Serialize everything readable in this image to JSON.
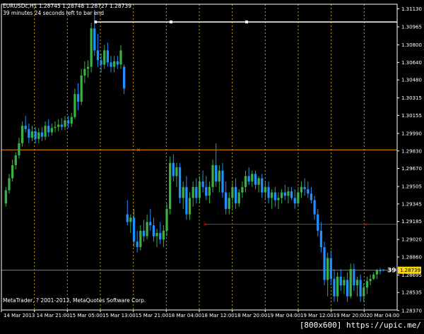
{
  "header": {
    "symbol_line": "EURUSDc,H1  1.28745 1.28748 1.28727 1.28739",
    "countdown": "39 minutes 24 seconds left to bar end"
  },
  "copyright": "MetaTrader, ? 2001-2013, MetaQuotes Software Corp.",
  "countdown_short": "39",
  "watermark": "[800x600] https://upic.me/",
  "colors": {
    "background": "#000000",
    "bull": "#3cb043",
    "bear": "#1e90ff",
    "grid": "#c8a000",
    "axis": "#ffffff",
    "orange_line": "#ff8c00",
    "red_line": "#ff0000",
    "white_line": "#ffffff",
    "price_label_bg": "#ffd700"
  },
  "chart_data": {
    "type": "candlestick",
    "ylim": [
      1.28375,
      1.31172
    ],
    "y_ticks": [
      "1.31130",
      "1.30965",
      "1.30800",
      "1.30640",
      "1.30480",
      "1.30315",
      "1.30155",
      "1.29990",
      "1.29830",
      "1.29670",
      "1.29505",
      "1.29345",
      "1.29185",
      "1.29020",
      "1.28860",
      "1.28695",
      "1.28535",
      "1.28370"
    ],
    "x_labels": [
      "14 Mar 2013",
      "14 Mar 21:00",
      "15 Mar 05:00",
      "15 Mar 13:00",
      "15 Mar 21:00",
      "18 Mar 04:00",
      "18 Mar 12:00",
      "18 Mar 20:00",
      "19 Mar 04:00",
      "19 Mar 12:00",
      "19 Mar 20:00",
      "20 Mar 04:00"
    ],
    "current_price": "1.28739",
    "current_price_value": 1.28739,
    "horizontal_lines": [
      {
        "name": "white-hline",
        "price": 1.3101,
        "color": "#ffffff"
      },
      {
        "name": "orange-hline",
        "price": 1.2984,
        "color": "#ff8c00"
      },
      {
        "name": "red-hline",
        "price": 1.2916,
        "color": "#ff0000"
      },
      {
        "name": "bid-hline",
        "price": 1.28739,
        "color": "#808080"
      }
    ],
    "candles": [
      [
        1.2935,
        1.295,
        1.2932,
        1.2947
      ],
      [
        1.2947,
        1.2962,
        1.2944,
        1.2958
      ],
      [
        1.2958,
        1.2975,
        1.2955,
        1.297
      ],
      [
        1.297,
        1.2982,
        1.2966,
        1.2979
      ],
      [
        1.2979,
        1.2995,
        1.2976,
        1.299
      ],
      [
        1.299,
        1.301,
        1.2987,
        1.3006
      ],
      [
        1.3006,
        1.3015,
        1.3,
        1.3003
      ],
      [
        1.3003,
        1.3008,
        1.299,
        1.2995
      ],
      [
        1.2995,
        1.3006,
        1.2992,
        1.3001
      ],
      [
        1.3001,
        1.3005,
        1.299,
        1.2994
      ],
      [
        1.2994,
        1.3004,
        1.299,
        1.3
      ],
      [
        1.3,
        1.3005,
        1.2992,
        1.2996
      ],
      [
        1.2996,
        1.301,
        1.2993,
        1.3006
      ],
      [
        1.3006,
        1.3012,
        1.2996,
        1.3
      ],
      [
        1.3,
        1.3008,
        1.2997,
        1.3004
      ],
      [
        1.3004,
        1.301,
        1.3,
        1.3005
      ],
      [
        1.3005,
        1.3012,
        1.3001,
        1.3007
      ],
      [
        1.3007,
        1.3013,
        1.3002,
        1.3005
      ],
      [
        1.3005,
        1.3015,
        1.3002,
        1.3011
      ],
      [
        1.3011,
        1.3015,
        1.3004,
        1.3008
      ],
      [
        1.3008,
        1.3018,
        1.3005,
        1.3014
      ],
      [
        1.3014,
        1.304,
        1.3012,
        1.3035
      ],
      [
        1.3035,
        1.3045,
        1.302,
        1.3028
      ],
      [
        1.3028,
        1.3058,
        1.3025,
        1.3052
      ],
      [
        1.3052,
        1.3065,
        1.3045,
        1.3058
      ],
      [
        1.3058,
        1.3066,
        1.305,
        1.306
      ],
      [
        1.306,
        1.31,
        1.3055,
        1.3095
      ],
      [
        1.3095,
        1.3112,
        1.307,
        1.3075
      ],
      [
        1.3075,
        1.309,
        1.306,
        1.3066
      ],
      [
        1.3066,
        1.3072,
        1.3055,
        1.3062
      ],
      [
        1.3062,
        1.308,
        1.3058,
        1.3075
      ],
      [
        1.3075,
        1.3082,
        1.306,
        1.3064
      ],
      [
        1.3064,
        1.307,
        1.3055,
        1.306
      ],
      [
        1.306,
        1.307,
        1.3055,
        1.3065
      ],
      [
        1.3065,
        1.307,
        1.3058,
        1.3062
      ],
      [
        1.3062,
        1.308,
        1.3058,
        1.3075
      ],
      [
        1.306,
        1.3062,
        1.3035,
        1.304
      ],
      [
        1.2925,
        1.2938,
        1.2915,
        1.2918
      ],
      [
        1.2918,
        1.2925,
        1.2908,
        1.2922
      ],
      [
        1.2922,
        1.293,
        1.2895,
        1.29
      ],
      [
        1.29,
        1.291,
        1.289,
        1.2895
      ],
      [
        1.2895,
        1.2915,
        1.2892,
        1.291
      ],
      [
        1.291,
        1.292,
        1.29,
        1.2905
      ],
      [
        1.2905,
        1.2925,
        1.2902,
        1.2918
      ],
      [
        1.2918,
        1.293,
        1.291,
        1.2915
      ],
      [
        1.2915,
        1.2922,
        1.29,
        1.2905
      ],
      [
        1.2905,
        1.2912,
        1.2895,
        1.2908
      ],
      [
        1.2908,
        1.2918,
        1.2898,
        1.2902
      ],
      [
        1.2902,
        1.2915,
        1.2895,
        1.291
      ],
      [
        1.291,
        1.2935,
        1.2905,
        1.293
      ],
      [
        1.293,
        1.2978,
        1.2925,
        1.2972
      ],
      [
        1.2972,
        1.298,
        1.2955,
        1.296
      ],
      [
        1.296,
        1.2972,
        1.295,
        1.2968
      ],
      [
        1.2968,
        1.2972,
        1.2935,
        1.294
      ],
      [
        1.294,
        1.2955,
        1.293,
        1.295
      ],
      [
        1.295,
        1.296,
        1.292,
        1.2925
      ],
      [
        1.2925,
        1.2945,
        1.292,
        1.294
      ],
      [
        1.294,
        1.2955,
        1.2932,
        1.295
      ],
      [
        1.295,
        1.2958,
        1.2935,
        1.294
      ],
      [
        1.294,
        1.296,
        1.2935,
        1.2955
      ],
      [
        1.2955,
        1.2965,
        1.2945,
        1.295
      ],
      [
        1.295,
        1.296,
        1.2938,
        1.2942
      ],
      [
        1.2942,
        1.2955,
        1.2935,
        1.295
      ],
      [
        1.295,
        1.2975,
        1.2945,
        1.297
      ],
      [
        1.297,
        1.299,
        1.295,
        1.2955
      ],
      [
        1.2955,
        1.297,
        1.2945,
        1.2965
      ],
      [
        1.2965,
        1.2972,
        1.294,
        1.2945
      ],
      [
        1.2945,
        1.2955,
        1.2925,
        1.293
      ],
      [
        1.293,
        1.2945,
        1.2925,
        1.294
      ],
      [
        1.294,
        1.2955,
        1.293,
        1.295
      ],
      [
        1.295,
        1.2958,
        1.293,
        1.2935
      ],
      [
        1.2935,
        1.2948,
        1.2932,
        1.2945
      ],
      [
        1.2945,
        1.2955,
        1.294,
        1.295
      ],
      [
        1.295,
        1.2965,
        1.2945,
        1.296
      ],
      [
        1.296,
        1.2968,
        1.2952,
        1.2955
      ],
      [
        1.2955,
        1.2965,
        1.295,
        1.2962
      ],
      [
        1.2962,
        1.2965,
        1.2948,
        1.2952
      ],
      [
        1.2952,
        1.296,
        1.2945,
        1.2958
      ],
      [
        1.2958,
        1.2962,
        1.294,
        1.2945
      ],
      [
        1.2945,
        1.2955,
        1.2938,
        1.295
      ],
      [
        1.295,
        1.2955,
        1.2935,
        1.294
      ],
      [
        1.294,
        1.2948,
        1.293,
        1.2945
      ],
      [
        1.2945,
        1.295,
        1.2932,
        1.2938
      ],
      [
        1.2938,
        1.2945,
        1.293,
        1.294
      ],
      [
        1.294,
        1.2948,
        1.2935,
        1.2945
      ],
      [
        1.2945,
        1.2952,
        1.2938,
        1.2942
      ],
      [
        1.2942,
        1.295,
        1.2935,
        1.2946
      ],
      [
        1.2946,
        1.295,
        1.2938,
        1.294
      ],
      [
        1.294,
        1.2948,
        1.293,
        1.2935
      ],
      [
        1.2935,
        1.295,
        1.2932,
        1.2945
      ],
      [
        1.2945,
        1.2955,
        1.294,
        1.295
      ],
      [
        1.295,
        1.2958,
        1.2942,
        1.2948
      ],
      [
        1.2948,
        1.2955,
        1.294,
        1.2944
      ],
      [
        1.2944,
        1.295,
        1.2935,
        1.2938
      ],
      [
        1.2938,
        1.2942,
        1.292,
        1.2925
      ],
      [
        1.2925,
        1.293,
        1.2905,
        1.291
      ],
      [
        1.291,
        1.2918,
        1.289,
        1.2895
      ],
      [
        1.2895,
        1.29,
        1.286,
        1.2865
      ],
      [
        1.2865,
        1.289,
        1.285,
        1.2885
      ],
      [
        1.2885,
        1.2892,
        1.286,
        1.2866
      ],
      [
        1.2866,
        1.2875,
        1.2845,
        1.285
      ],
      [
        1.285,
        1.2872,
        1.2845,
        1.2868
      ],
      [
        1.2868,
        1.2875,
        1.2855,
        1.286
      ],
      [
        1.286,
        1.2868,
        1.2852,
        1.2865
      ],
      [
        1.2865,
        1.2872,
        1.2845,
        1.285
      ],
      [
        1.285,
        1.288,
        1.2848,
        1.2875
      ],
      [
        1.2875,
        1.288,
        1.2855,
        1.286
      ],
      [
        1.286,
        1.2868,
        1.285,
        1.2865
      ],
      [
        1.2865,
        1.287,
        1.2845,
        1.285
      ],
      [
        1.285,
        1.2862,
        1.2845,
        1.2858
      ],
      [
        1.2858,
        1.2868,
        1.2852,
        1.2864
      ],
      [
        1.2864,
        1.287,
        1.286,
        1.2866
      ],
      [
        1.2866,
        1.2872,
        1.2865,
        1.287
      ],
      [
        1.287,
        1.2875,
        1.2866,
        1.2874
      ],
      [
        1.2874,
        1.2876,
        1.287,
        1.2873
      ],
      [
        1.28745,
        1.28748,
        1.28727,
        1.28739
      ]
    ]
  }
}
